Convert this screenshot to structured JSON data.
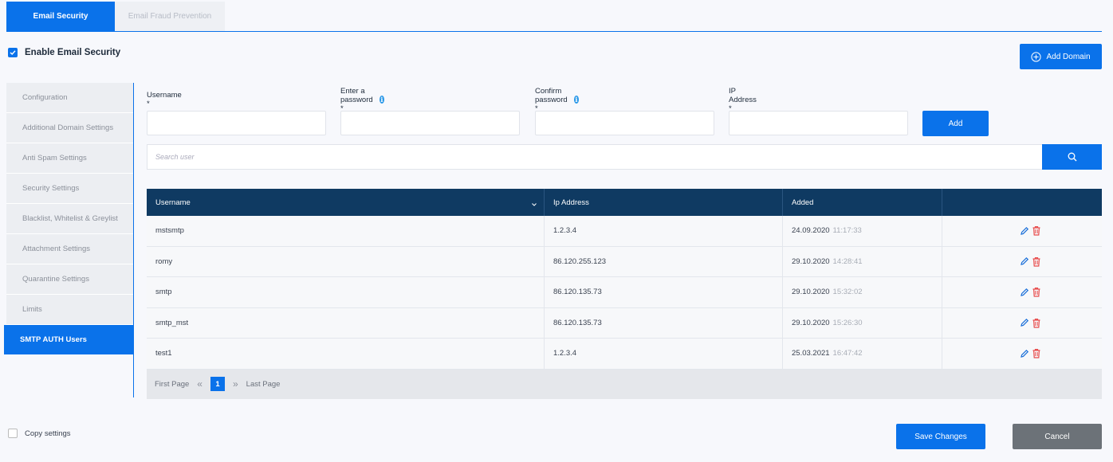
{
  "tabs": [
    {
      "label": "Email Security",
      "active": true
    },
    {
      "label": "Email Fraud Prevention",
      "active": false
    }
  ],
  "enable_checkbox": {
    "label": "Enable Email Security",
    "checked": true
  },
  "add_domain_label": "Add Domain",
  "sidebar": {
    "items": [
      {
        "label": "Configuration",
        "active": false
      },
      {
        "label": "Additional Domain Settings",
        "active": false
      },
      {
        "label": "Anti Spam Settings",
        "active": false
      },
      {
        "label": "Security Settings",
        "active": false
      },
      {
        "label": "Blacklist, Whitelist & Greylist",
        "active": false
      },
      {
        "label": "Attachment Settings",
        "active": false
      },
      {
        "label": "Quarantine Settings",
        "active": false
      },
      {
        "label": "Limits",
        "active": false
      },
      {
        "label": "SMTP AUTH Users",
        "active": true
      }
    ]
  },
  "form": {
    "username_label": "Username *",
    "password_label": "Enter a password *",
    "confirm_label": "Confirm password *",
    "ip_label": "IP Address *",
    "info_glyph": "i",
    "add_label": "Add"
  },
  "search": {
    "placeholder": "Search user"
  },
  "table": {
    "headers": [
      "Username",
      "Ip Address",
      "Added",
      ""
    ],
    "rows": [
      {
        "username": "mstsmtp",
        "ip": "1.2.3.4",
        "date": "24.09.2020",
        "time": "11:17:33"
      },
      {
        "username": "romy",
        "ip": "86.120.255.123",
        "date": "29.10.2020",
        "time": "14:28:41"
      },
      {
        "username": "smtp",
        "ip": "86.120.135.73",
        "date": "29.10.2020",
        "time": "15:32:02"
      },
      {
        "username": "smtp_mst",
        "ip": "86.120.135.73",
        "date": "29.10.2020",
        "time": "15:26:30"
      },
      {
        "username": "test1",
        "ip": "1.2.3.4",
        "date": "25.03.2021",
        "time": "16:47:42"
      }
    ]
  },
  "pagination": {
    "first": "First Page",
    "prev_glyph": "«",
    "current": "1",
    "next_glyph": "»",
    "last": "Last Page"
  },
  "copy_settings": {
    "label": "Copy settings",
    "checked": false
  },
  "save_label": "Save Changes",
  "cancel_label": "Cancel",
  "colors": {
    "accent": "#0a72ea",
    "header": "#0f3a62",
    "delete": "#e84c4c",
    "edit": "#1a6fd8"
  }
}
